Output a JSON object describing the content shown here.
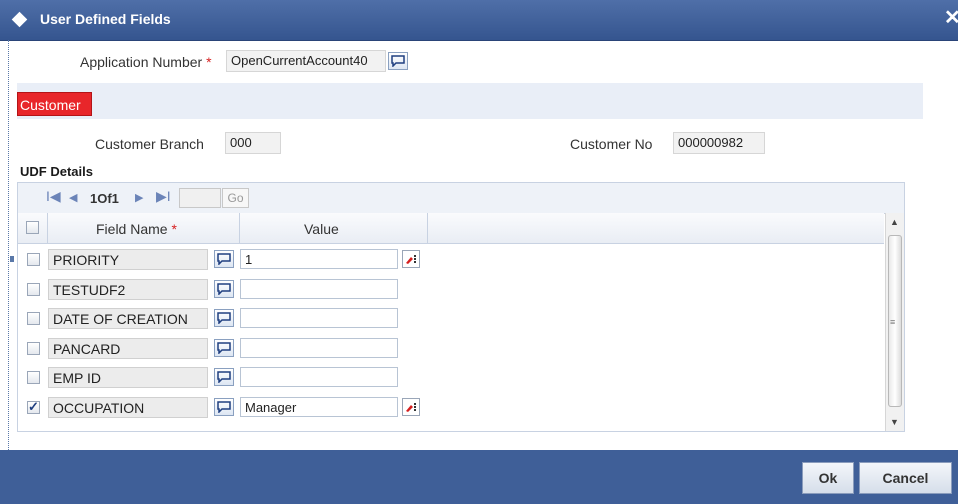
{
  "window": {
    "title": "User Defined Fields",
    "close_glyph": "✕"
  },
  "application": {
    "label": "Application Number",
    "required_mark": "*",
    "value": "OpenCurrentAccount40"
  },
  "section": {
    "tag": "Customer"
  },
  "customer": {
    "branch_label": "Customer Branch",
    "branch_value": "000",
    "no_label": "Customer No",
    "no_value": "000000982"
  },
  "udf": {
    "heading": "UDF Details",
    "pager": {
      "first": "I◀",
      "prev": "◀",
      "info": "1Of1",
      "next": "▶",
      "last": "▶I",
      "page_value": "",
      "go_label": "Go"
    },
    "columns": {
      "field_name": "Field Name",
      "required_mark": "*",
      "value": "Value"
    },
    "rows": [
      {
        "name": "PRIORITY",
        "value": "1",
        "checked": false,
        "has_edit": true
      },
      {
        "name": "TESTUDF2",
        "value": "",
        "checked": false,
        "has_edit": false
      },
      {
        "name": "DATE OF CREATION",
        "value": "",
        "checked": false,
        "has_edit": false
      },
      {
        "name": "PANCARD",
        "value": "",
        "checked": false,
        "has_edit": false
      },
      {
        "name": "EMP ID",
        "value": "",
        "checked": false,
        "has_edit": false
      },
      {
        "name": "OCCUPATION",
        "value": "Manager",
        "checked": true,
        "has_edit": true
      }
    ]
  },
  "buttons": {
    "ok": "Ok",
    "cancel": "Cancel"
  },
  "icons": {
    "lov": "lov-speech-bubble-icon",
    "edit": "edit-pencil-icon",
    "header": "diamond-icon"
  },
  "colors": {
    "title_bar": "#3f5f98",
    "section_tag": "#e8262a",
    "footer": "#3f5f98"
  }
}
